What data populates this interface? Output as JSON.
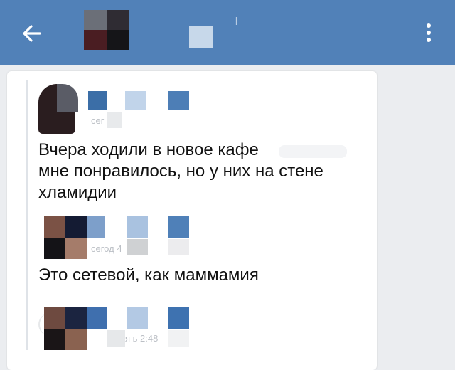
{
  "header": {
    "back_icon": "arrow-left-icon",
    "more_icon": "more-vertical-icon",
    "title_fragment": "ı",
    "colors": {
      "bar": "#5181b8",
      "background": "#ebedf0"
    }
  },
  "messages": [
    {
      "text": "Вчера ходили в новое кафе\nмне понравилось, но у них на стене\nхламидии",
      "time": "сег"
    },
    {
      "text": "Это сетевой, как маммамия",
      "time": "сегод        4"
    },
    {
      "text": "",
      "time": "я ь   2:48"
    }
  ]
}
